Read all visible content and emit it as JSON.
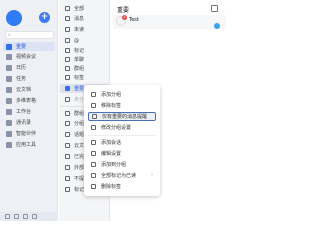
{
  "nav": {
    "plus": "+",
    "items": [
      {
        "label": "重要",
        "icon": "star-icon"
      },
      {
        "label": "视频会议",
        "icon": "video-icon"
      },
      {
        "label": "日历",
        "icon": "calendar-icon"
      },
      {
        "label": "任务",
        "icon": "task-icon"
      },
      {
        "label": "云文档",
        "icon": "doc-icon"
      },
      {
        "label": "多维表格",
        "icon": "table-icon"
      },
      {
        "label": "工作台",
        "icon": "workbench-icon"
      },
      {
        "label": "通讯录",
        "icon": "contacts-icon"
      },
      {
        "label": "智能伙伴",
        "icon": "ai-icon"
      },
      {
        "label": "应用工具",
        "icon": "apps-icon"
      }
    ]
  },
  "list": {
    "items": [
      {
        "label": "全部",
        "icon": "chat-icon"
      },
      {
        "label": "消息",
        "icon": "message-icon"
      },
      {
        "label": "未读",
        "icon": "unread-icon"
      },
      {
        "label": "@",
        "icon": "at-icon"
      },
      {
        "label": "标记",
        "icon": "flag-icon"
      },
      {
        "label": "单聊",
        "icon": "person-icon"
      },
      {
        "label": "群组",
        "icon": "group-icon"
      },
      {
        "label": "标签",
        "icon": "tag-icon"
      },
      {
        "label": "重要",
        "icon": "star-icon"
      },
      {
        "label": "未分组",
        "icon": "folder-icon"
      },
      {
        "label": "群组",
        "icon": "group-icon"
      },
      {
        "label": "分组",
        "icon": "folder-icon"
      },
      {
        "label": "话题",
        "icon": "topic-icon"
      },
      {
        "label": "云文档",
        "icon": "doc-icon"
      },
      {
        "label": "已完成",
        "icon": "done-icon"
      },
      {
        "label": "外部",
        "icon": "external-icon"
      },
      {
        "label": "不提醒",
        "icon": "mute-icon"
      },
      {
        "label": "标记",
        "icon": "flag-icon"
      }
    ]
  },
  "chat": {
    "title": "重要",
    "conversation": {
      "badge": "1",
      "name": "Test",
      "snippet": "",
      "time": ""
    }
  },
  "menu": {
    "items": [
      {
        "label": "添加分组",
        "icon": "add-group-icon"
      },
      {
        "label": "移除标签",
        "icon": "remove-icon"
      },
      {
        "label": "仅有重要的消息提醒",
        "icon": "bell-icon"
      },
      {
        "label": "修改分组设置",
        "icon": "settings-icon"
      },
      {
        "label": "添加会话",
        "icon": "add-icon"
      },
      {
        "label": "编辑设置",
        "icon": "edit-icon"
      },
      {
        "label": "添加到分组",
        "icon": "move-icon"
      },
      {
        "label": "全部标记为已读",
        "icon": "read-icon"
      },
      {
        "label": "删除标签",
        "icon": "delete-icon"
      }
    ]
  }
}
